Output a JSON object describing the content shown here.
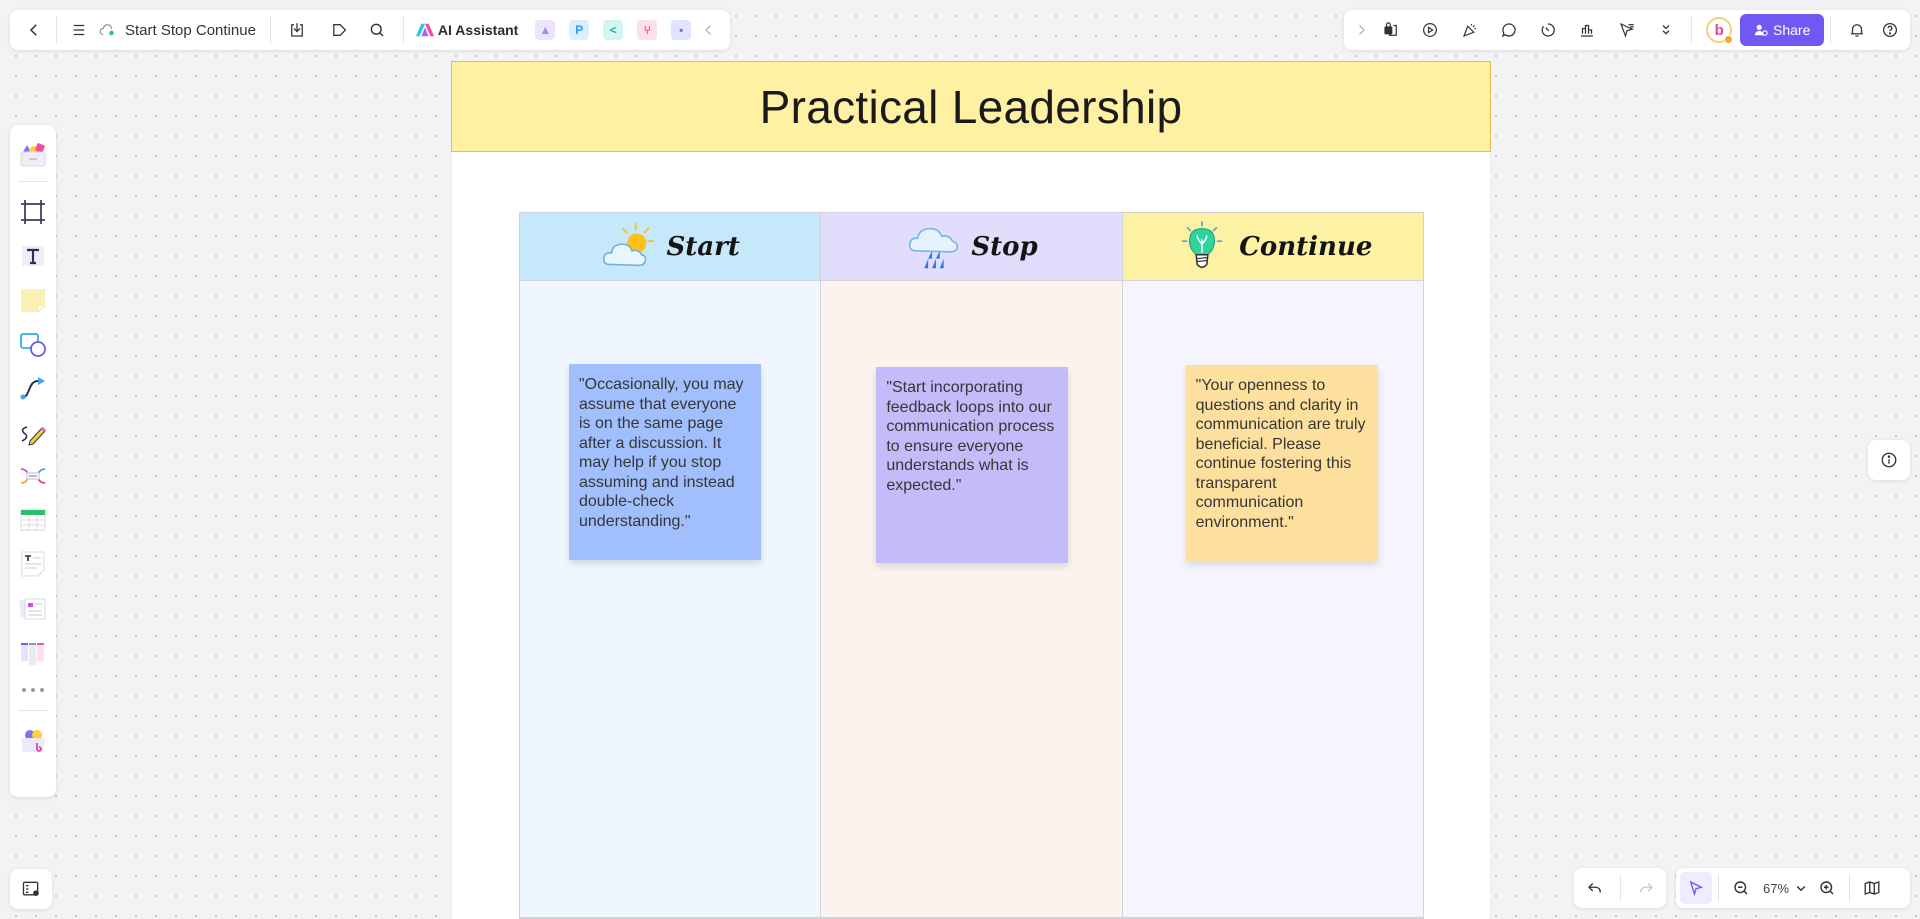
{
  "toolbar_left": {
    "doc_title": "Start Stop Continue",
    "ai_label": "AI Assistant",
    "icons": [
      "back-icon",
      "menu-icon",
      "cloud-sync-icon",
      "download-icon",
      "tag-icon",
      "search-icon"
    ],
    "apps": [
      {
        "name": "image-generator-app",
        "glyph": "▲",
        "bg": "#ece4fb",
        "fg": "#a88ae6"
      },
      {
        "name": "presentation-app",
        "glyph": "P",
        "bg": "#dcefff",
        "fg": "#2a9df4"
      },
      {
        "name": "mindmap-app",
        "glyph": "<",
        "bg": "#d4f5ef",
        "fg": "#14b8a0"
      },
      {
        "name": "flowchart-app",
        "glyph": "⑂",
        "bg": "#ffe0ea",
        "fg": "#f0558d"
      },
      {
        "name": "chat-app",
        "glyph": "▪",
        "bg": "#e2e4ff",
        "fg": "#6c6ff2"
      }
    ]
  },
  "toolbar_right": {
    "share_label": "Share",
    "avatar_letter": "b",
    "accent": "#7059f3"
  },
  "board": {
    "title": "Practical Leadership",
    "columns": [
      {
        "label": "Start",
        "icon": "sun-cloud-icon",
        "header_bg": "#c5e8fb",
        "body_bg": "#eff6fe",
        "note": {
          "text": " \"Occasionally, you may assume that everyone is on the same page after a discussion. It may help if you stop assuming and instead double-check understanding.\"",
          "bg": "#a0bffc"
        }
      },
      {
        "label": "Stop",
        "icon": "rain-cloud-icon",
        "header_bg": "#e0defc",
        "body_bg": "#fcf3ee",
        "note": {
          "text": "\"Start incorporating feedback loops into our communication process to ensure everyone understands what is expected.\"",
          "bg": "#c4bcf9"
        }
      },
      {
        "label": "Continue",
        "icon": "lightbulb-icon",
        "header_bg": "#fdf1a4",
        "body_bg": "#f5f5fd",
        "note": {
          "text": "\"Your openness to questions and clarity in communication are truly beneficial. Please continue fostering this transparent communication environment.\"",
          "bg": "#fde09e"
        }
      }
    ]
  },
  "bottom_bar": {
    "zoom_level": "67%"
  }
}
